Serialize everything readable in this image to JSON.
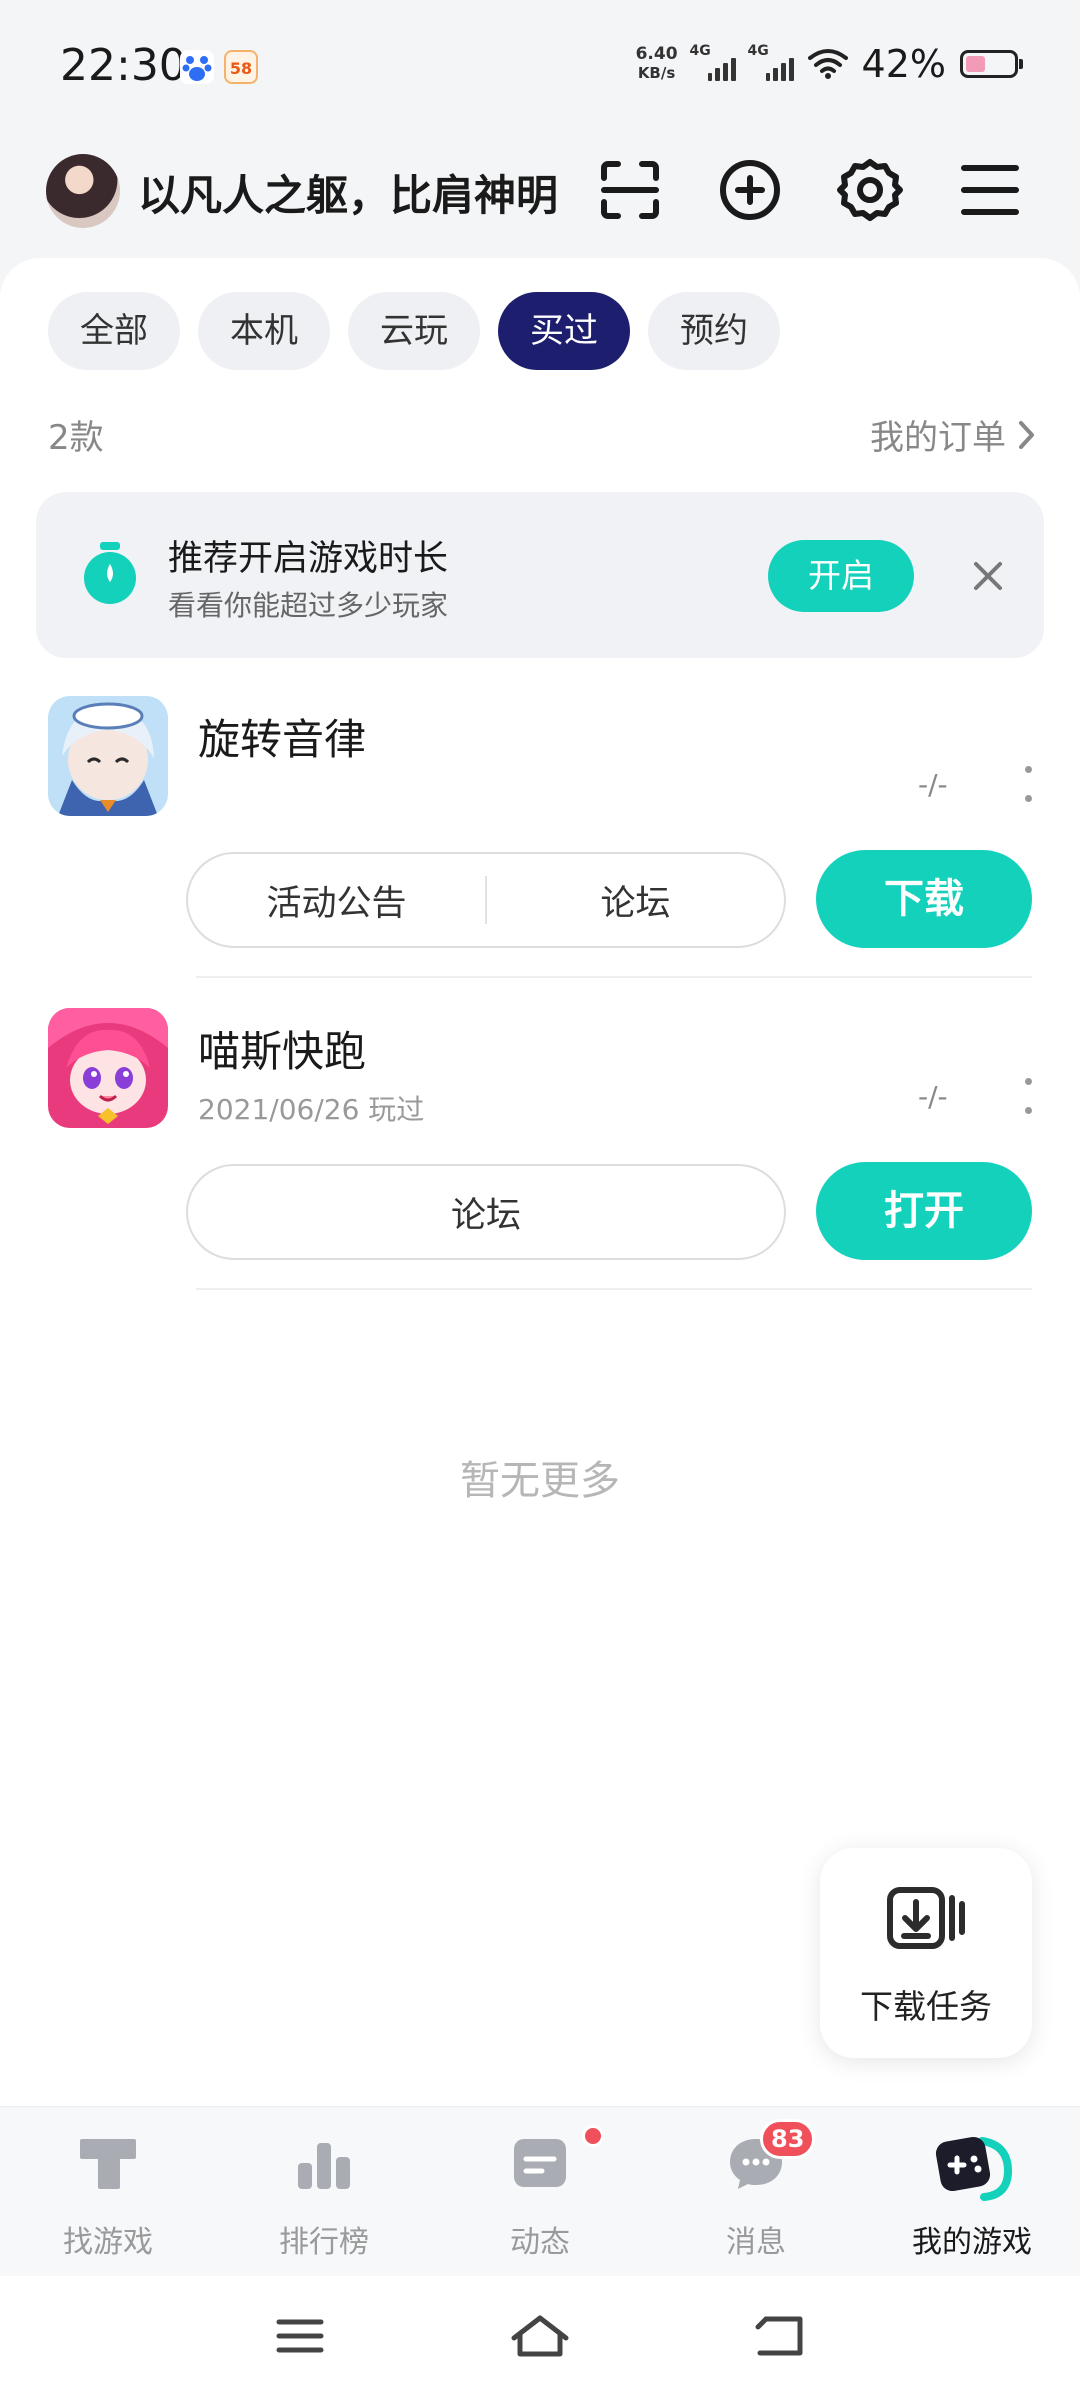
{
  "status_bar": {
    "time": "22:30",
    "app_icons": [
      "baidu-icon",
      "58-icon"
    ],
    "app_58_label": "58",
    "net_speed_value": "6.40",
    "net_speed_unit": "KB/s",
    "signal1": "4G",
    "signal2": "4G",
    "battery_pct": "42%",
    "battery_level": 0.42
  },
  "header": {
    "username": "以凡人之躯，比肩神明",
    "icons": [
      "scan-icon",
      "add-circle-icon",
      "settings-icon",
      "menu-icon"
    ]
  },
  "tabs": [
    {
      "label": "全部",
      "active": false
    },
    {
      "label": "本机",
      "active": false
    },
    {
      "label": "云玩",
      "active": false
    },
    {
      "label": "买过",
      "active": true
    },
    {
      "label": "预约",
      "active": false
    }
  ],
  "list": {
    "count": "2款",
    "orders_link": "我的订单"
  },
  "banner": {
    "title": "推荐开启游戏时长",
    "subtitle": "看看你能超过多少玩家",
    "button": "开启"
  },
  "games": [
    {
      "name": "旋转音律",
      "subtitle": "",
      "score": "-/-",
      "actions": [
        "活动公告",
        "论坛"
      ],
      "primary": "下载"
    },
    {
      "name": "喵斯快跑",
      "subtitle": "2021/06/26 玩过",
      "score": "-/-",
      "actions": [
        "论坛"
      ],
      "primary": "打开"
    }
  ],
  "empty_text": "暂无更多",
  "download_task": {
    "label": "下载任务"
  },
  "bottom_nav": [
    {
      "label": "找游戏",
      "icon": "find-games-icon",
      "active": false
    },
    {
      "label": "排行榜",
      "icon": "ranking-icon",
      "active": false
    },
    {
      "label": "动态",
      "icon": "feed-icon",
      "active": false,
      "dot": true
    },
    {
      "label": "消息",
      "icon": "message-icon",
      "active": false,
      "badge": "83"
    },
    {
      "label": "我的游戏",
      "icon": "my-games-icon",
      "active": true
    }
  ],
  "colors": {
    "accent": "#14d1bc",
    "active_tab": "#1e1e6e",
    "badge": "#f0505a"
  }
}
